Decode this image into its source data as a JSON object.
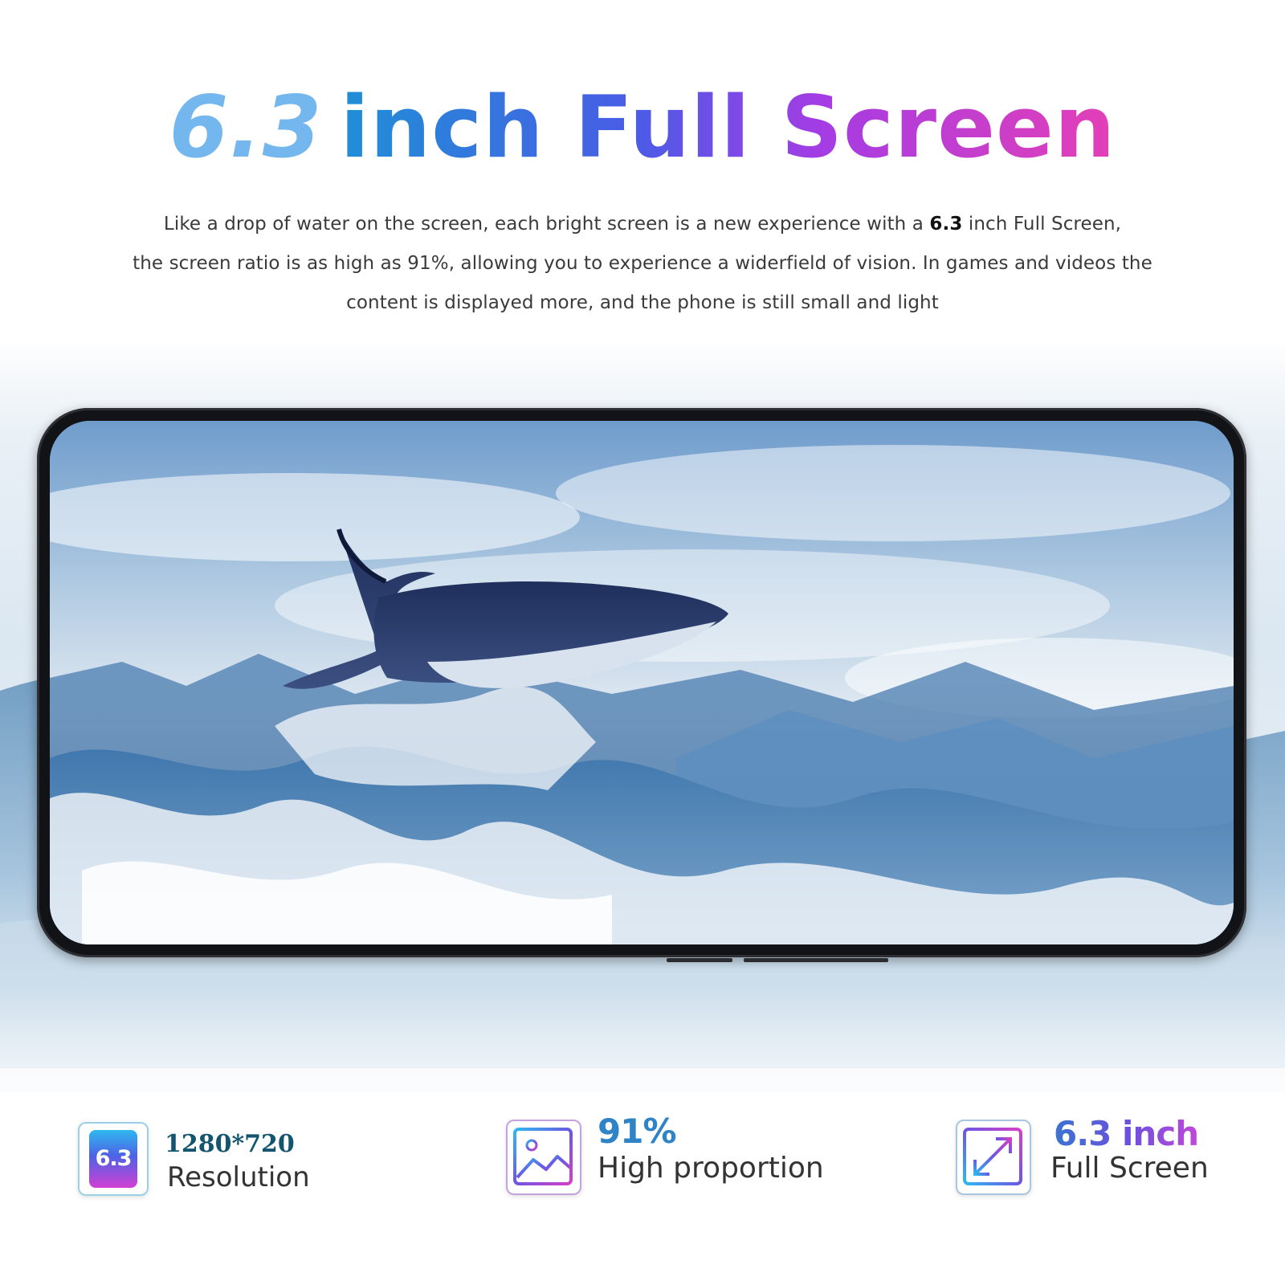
{
  "headline": {
    "number": "6.3",
    "rest": "inch Full Screen"
  },
  "description": {
    "line1_before": "Like a drop of water on the screen, each bright screen is a new experience with a ",
    "line1_bold": "6.3",
    "line1_after": " inch Full Screen,",
    "line2": "the screen ratio is as high as 91%, allowing you to experience a widerfield  of vision. In games and videos the",
    "line3": "content is displayed more, and the phone is still small and light"
  },
  "features": {
    "resolution": {
      "icon_text": "6.3",
      "value": "1280*720",
      "label": "Resolution",
      "icon": "phone-screen-icon"
    },
    "proportion": {
      "value": "91%",
      "label": "High proportion",
      "icon": "image-icon"
    },
    "screen": {
      "value": "6.3 inch",
      "label": "Full Screen",
      "icon": "expand-arrows-icon"
    }
  },
  "colors": {
    "headline_number": "#74b6ee",
    "headline_gradient_start": "#1f8fd6",
    "headline_gradient_end": "#e43fb6",
    "phone_frame": "#121316",
    "feature_value_blue": "#2f83c7"
  }
}
